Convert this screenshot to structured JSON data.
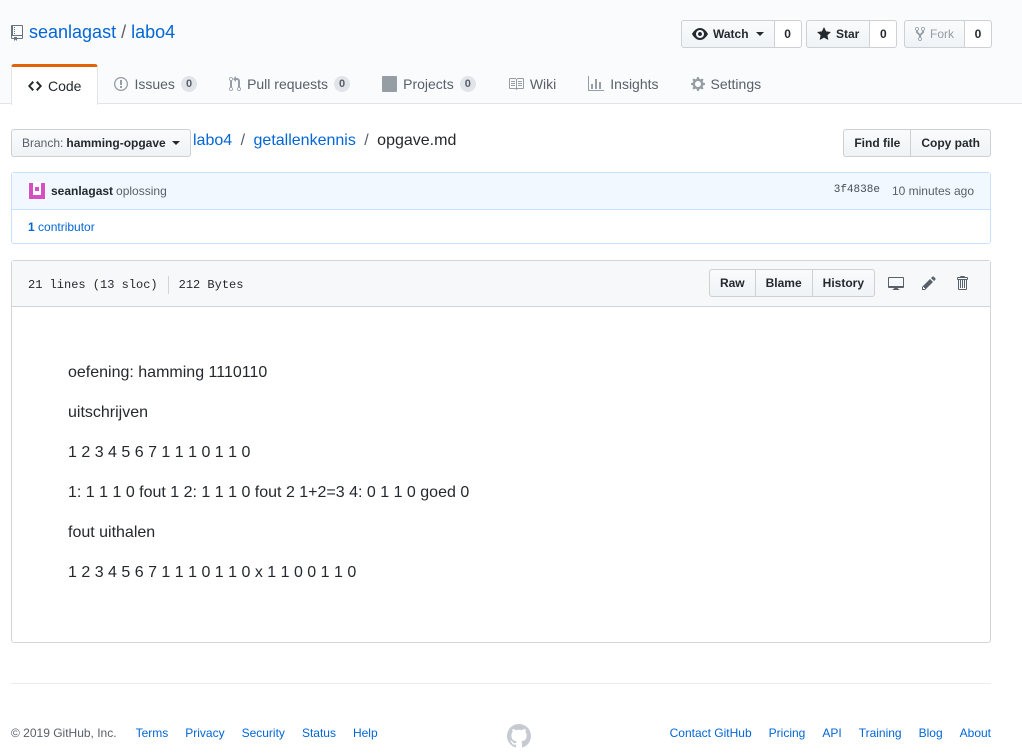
{
  "repo": {
    "owner": "seanlagast",
    "separator": "/",
    "name": "labo4"
  },
  "actions": {
    "watch": {
      "label": "Watch",
      "count": "0"
    },
    "star": {
      "label": "Star",
      "count": "0"
    },
    "fork": {
      "label": "Fork",
      "count": "0"
    }
  },
  "tabs": [
    {
      "label": "Code",
      "icon": "code-icon",
      "selected": true
    },
    {
      "label": "Issues",
      "count": "0",
      "icon": "issue-icon"
    },
    {
      "label": "Pull requests",
      "count": "0",
      "icon": "pull-request-icon"
    },
    {
      "label": "Projects",
      "count": "0",
      "icon": "project-icon"
    },
    {
      "label": "Wiki",
      "icon": "book-icon"
    },
    {
      "label": "Insights",
      "icon": "graph-icon"
    },
    {
      "label": "Settings",
      "icon": "gear-icon"
    }
  ],
  "branch": {
    "prefix": "Branch:",
    "name": "hamming-opgave"
  },
  "breadcrumb": {
    "repo": "labo4",
    "dir": "getallenkennis",
    "file": "opgave.md",
    "sep": "/"
  },
  "file_nav": {
    "find_file": "Find file",
    "copy_path": "Copy path"
  },
  "commit": {
    "author": "seanlagast",
    "message": "oplossing",
    "sha": "3f4838e",
    "time": "10 minutes ago",
    "contributors_count": "1",
    "contributors_label": "contributor"
  },
  "file": {
    "lines": "21 lines (13 sloc)",
    "size": "212 Bytes",
    "raw": "Raw",
    "blame": "Blame",
    "history": "History"
  },
  "content": [
    "oefening: hamming 1110110",
    "uitschrijven",
    "1 2 3 4 5 6 7 1 1 1 0 1 1 0",
    "1: 1 1 1 0 fout 1 2: 1 1 1 0 fout 2 1+2=3 4: 0 1 1 0 goed 0",
    "fout uithalen",
    "1 2 3 4 5 6 7 1 1 1 0 1 1 0 x 1 1 0 0 1 1 0"
  ],
  "footer": {
    "copyright": "© 2019 GitHub, Inc.",
    "left_links": [
      "Terms",
      "Privacy",
      "Security",
      "Status",
      "Help"
    ],
    "right_links": [
      "Contact GitHub",
      "Pricing",
      "API",
      "Training",
      "Blog",
      "About"
    ]
  },
  "colors": {
    "link": "#0366d6",
    "tab_accent": "#e36209",
    "text": "#24292e",
    "muted": "#586069"
  }
}
